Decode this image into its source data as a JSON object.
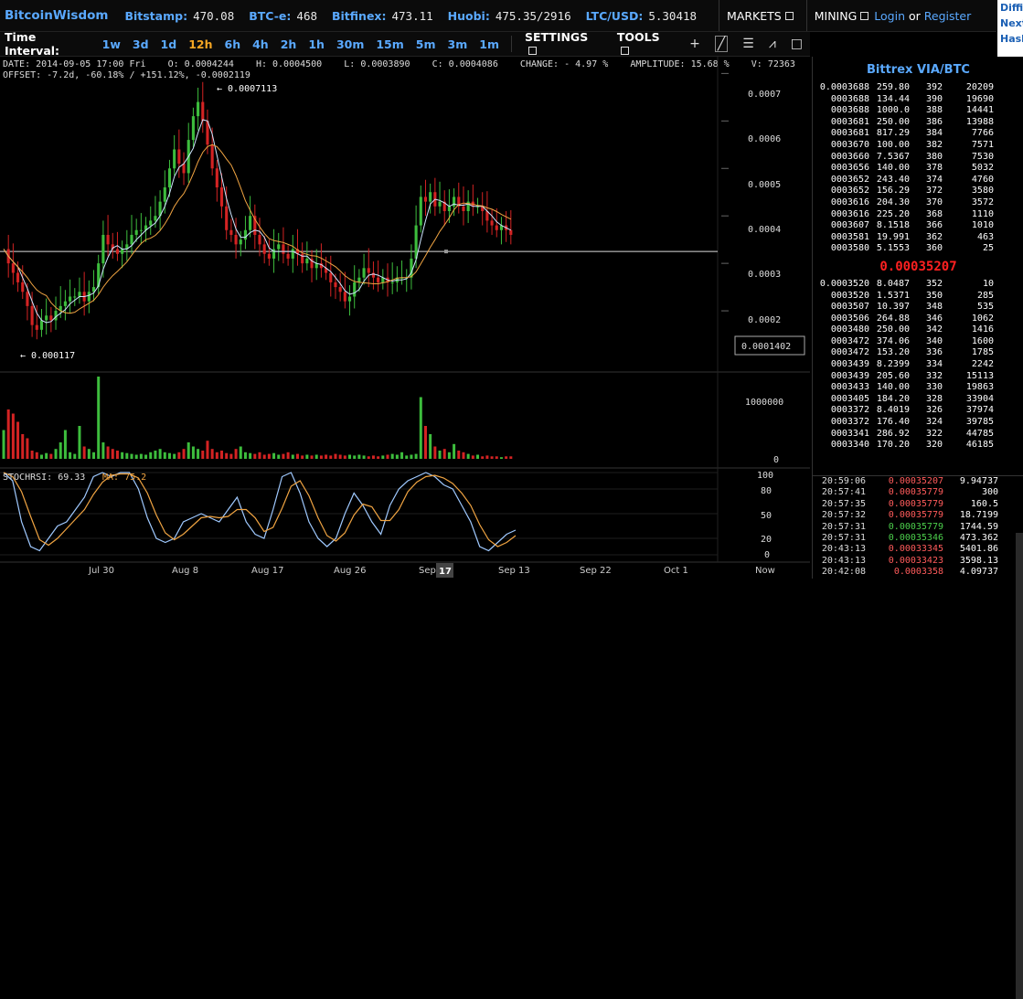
{
  "topbar": {
    "logo": "BitcoinWisdom",
    "exchanges": [
      {
        "name": "Bitstamp:",
        "price": "470.08"
      },
      {
        "name": "BTC-e:",
        "price": "468"
      },
      {
        "name": "Bitfinex:",
        "price": "473.11"
      },
      {
        "name": "Huobi:",
        "price": "475.35/2916"
      },
      {
        "name": "LTC/USD:",
        "price": "5.30418"
      }
    ],
    "markets_label": "MARKETS",
    "mining_label": "MINING",
    "login_label": "Login",
    "or_label": "or",
    "register_label": "Register"
  },
  "right_links": [
    "Diffi",
    "Next",
    "Hash"
  ],
  "intervals": {
    "label": "Time Interval:",
    "items": [
      "1w",
      "3d",
      "1d",
      "12h",
      "6h",
      "4h",
      "2h",
      "1h",
      "30m",
      "15m",
      "5m",
      "3m",
      "1m"
    ],
    "active": "12h",
    "settings_label": "SETTINGS",
    "tools_label": "TOOLS",
    "tool_icons": [
      "plus-icon",
      "line-tool-icon",
      "horizontal-lines-icon",
      "fan-icon",
      "square-icon"
    ]
  },
  "info": {
    "line1": "DATE: 2014-09-05 17:00 Fri    O: 0.0004244    H: 0.0004500    L: 0.0003890    C: 0.0004086    CHANGE: - 4.97 %    AMPLITUDE: 15.68 %    V: 72363",
    "line2": "OFFSET: -7.2d, -60.18% / +151.12%, -0.0002119"
  },
  "chart_data": {
    "type": "candlestick",
    "price_axis": {
      "ticks": [
        "0.0007",
        "0.0006",
        "0.0005",
        "0.0004",
        "0.0003",
        "0.0002"
      ],
      "range": [
        0.0001,
        0.00072
      ]
    },
    "high_label": "← 0.0007113",
    "low_label": "← 0.000117",
    "cursor_price": "0.0001402",
    "crosshair_price": 0.000325,
    "volume_axis": {
      "ticks": [
        "1000000",
        "0"
      ]
    },
    "stoch_label": "STOCHRSI: 69.33",
    "ma_label": "MA: 75.2",
    "stoch_axis": {
      "ticks": [
        "100",
        "80",
        "50",
        "20",
        "0"
      ]
    },
    "x_labels": [
      "Jul 30",
      "Aug 8",
      "Aug 17",
      "Aug 26",
      "Sep",
      "17",
      "Sep 13",
      "Sep 22",
      "Oct 1",
      "Now"
    ],
    "price_path": [
      0.00033,
      0.0003,
      0.00028,
      0.00026,
      0.00024,
      0.00021,
      0.00017,
      0.00016,
      0.00018,
      0.00019,
      0.00018,
      0.0002,
      0.00021,
      0.00022,
      0.00023,
      0.00023,
      0.00024,
      0.00022,
      0.00024,
      0.00025,
      0.0003,
      0.00036,
      0.00034,
      0.00033,
      0.00032,
      0.00033,
      0.00034,
      0.00036,
      0.00037,
      0.00037,
      0.00038,
      0.00039,
      0.0004,
      0.00043,
      0.00046,
      0.0005,
      0.00054,
      0.00051,
      0.00049,
      0.00056,
      0.00061,
      0.00064,
      0.0006,
      0.00055,
      0.0005,
      0.00046,
      0.00042,
      0.00037,
      0.00036,
      0.00034,
      0.00035,
      0.00037,
      0.0004,
      0.00036,
      0.00034,
      0.00032,
      0.00031,
      0.00033,
      0.00034,
      0.00032,
      0.00031,
      0.00033,
      0.00032,
      0.0003,
      0.00031,
      0.00029,
      0.0003,
      0.00029,
      0.00028,
      0.00026,
      0.00025,
      0.00024,
      0.00022,
      0.00023,
      0.00026,
      0.00027,
      0.00029,
      0.00028,
      0.00027,
      0.00026,
      0.00027,
      0.00026,
      0.00026,
      0.00027,
      0.00027,
      0.00027,
      0.00031,
      0.00038,
      0.00044,
      0.00043,
      0.00045,
      0.00042,
      0.00043,
      0.00041,
      0.00042,
      0.00044,
      0.00042,
      0.00041,
      0.00043,
      0.00042,
      0.00042,
      0.00041,
      0.00039,
      0.00038,
      0.00037,
      0.00038,
      0.00037,
      0.00036
    ],
    "volume_path": [
      0.35,
      0.6,
      0.55,
      0.45,
      0.3,
      0.25,
      0.1,
      0.08,
      0.05,
      0.07,
      0.06,
      0.12,
      0.2,
      0.35,
      0.08,
      0.06,
      0.4,
      0.15,
      0.12,
      0.08,
      1.0,
      0.2,
      0.15,
      0.12,
      0.1,
      0.08,
      0.07,
      0.06,
      0.05,
      0.06,
      0.05,
      0.08,
      0.1,
      0.12,
      0.08,
      0.07,
      0.06,
      0.08,
      0.12,
      0.2,
      0.15,
      0.12,
      0.1,
      0.22,
      0.12,
      0.08,
      0.1,
      0.07,
      0.06,
      0.12,
      0.15,
      0.08,
      0.07,
      0.06,
      0.08,
      0.05,
      0.06,
      0.07,
      0.05,
      0.06,
      0.08,
      0.05,
      0.06,
      0.04,
      0.05,
      0.04,
      0.05,
      0.04,
      0.05,
      0.04,
      0.06,
      0.05,
      0.04,
      0.05,
      0.04,
      0.05,
      0.04,
      0.03,
      0.04,
      0.03,
      0.04,
      0.05,
      0.06,
      0.05,
      0.08,
      0.04,
      0.05,
      0.06,
      0.75,
      0.4,
      0.3,
      0.15,
      0.1,
      0.12,
      0.08,
      0.18,
      0.1,
      0.08,
      0.06,
      0.04,
      0.05,
      0.03,
      0.04,
      0.03,
      0.03,
      0.02,
      0.03,
      0.03
    ],
    "stoch_path": [
      100,
      90,
      40,
      10,
      5,
      20,
      35,
      40,
      55,
      70,
      95,
      100,
      95,
      100,
      100,
      80,
      45,
      20,
      15,
      20,
      40,
      45,
      50,
      45,
      40,
      55,
      70,
      40,
      25,
      20,
      55,
      95,
      100,
      75,
      40,
      20,
      10,
      20,
      50,
      75,
      60,
      40,
      25,
      60,
      80,
      90,
      95,
      100,
      95,
      85,
      80,
      60,
      40,
      10,
      5,
      15,
      25,
      30
    ],
    "colors": {
      "up": "#3dbd3d",
      "down": "#d42323",
      "ma_fast": "#cfe6ff",
      "ma_slow": "#f0a442",
      "stoch": "#9fc9ff",
      "stoch_ma": "#f0a442"
    }
  },
  "book": {
    "title": "Bittrex VIA/BTC",
    "asks": [
      [
        "0.0003688",
        "259.80",
        "392",
        "20209"
      ],
      [
        "0003688",
        "134.44",
        "390",
        "19690"
      ],
      [
        "0003688",
        "1000.0",
        "388",
        "14441"
      ],
      [
        "0003681",
        "250.00",
        "386",
        "13988"
      ],
      [
        "0003681",
        "817.29",
        "384",
        "7766"
      ],
      [
        "0003670",
        "100.00",
        "382",
        "7571"
      ],
      [
        "0003660",
        "7.5367",
        "380",
        "7530"
      ],
      [
        "0003656",
        "140.00",
        "378",
        "5032"
      ],
      [
        "0003652",
        "243.40",
        "374",
        "4760"
      ],
      [
        "0003652",
        "156.29",
        "372",
        "3580"
      ],
      [
        "0003616",
        "204.30",
        "370",
        "3572"
      ],
      [
        "0003616",
        "225.20",
        "368",
        "1110"
      ],
      [
        "0003607",
        "8.1518",
        "366",
        "1010"
      ],
      [
        "0003581",
        "19.991",
        "362",
        "463"
      ],
      [
        "0003580",
        "5.1553",
        "360",
        "25"
      ]
    ],
    "last_price": "0.00035207",
    "bids": [
      [
        "0.0003520",
        "8.0487",
        "352",
        "10"
      ],
      [
        "0003520",
        "1.5371",
        "350",
        "285"
      ],
      [
        "0003507",
        "10.397",
        "348",
        "535"
      ],
      [
        "0003506",
        "264.88",
        "346",
        "1062"
      ],
      [
        "0003480",
        "250.00",
        "342",
        "1416"
      ],
      [
        "0003472",
        "374.06",
        "340",
        "1600"
      ],
      [
        "0003472",
        "153.20",
        "336",
        "1785"
      ],
      [
        "0003439",
        "8.2399",
        "334",
        "2242"
      ],
      [
        "0003439",
        "205.60",
        "332",
        "15113"
      ],
      [
        "0003433",
        "140.00",
        "330",
        "19863"
      ],
      [
        "0003405",
        "184.20",
        "328",
        "33904"
      ],
      [
        "0003372",
        "8.4019",
        "326",
        "37974"
      ],
      [
        "0003372",
        "176.40",
        "324",
        "39785"
      ],
      [
        "0003341",
        "286.92",
        "322",
        "44785"
      ],
      [
        "0003340",
        "170.20",
        "320",
        "46185"
      ]
    ],
    "trades": [
      [
        "20:59:06",
        "0.00035207",
        "9.94737",
        "red"
      ],
      [
        "20:57:41",
        "0.00035779",
        "300",
        "red"
      ],
      [
        "20:57:35",
        "0.00035779",
        "160.5",
        "red"
      ],
      [
        "20:57:32",
        "0.00035779",
        "18.7199",
        "red"
      ],
      [
        "20:57:31",
        "0.00035779",
        "1744.59",
        "green"
      ],
      [
        "20:57:31",
        "0.00035346",
        "473.362",
        "green"
      ],
      [
        "20:43:13",
        "0.00033345",
        "5401.86",
        "red"
      ],
      [
        "20:43:13",
        "0.00033423",
        "3598.13",
        "red"
      ],
      [
        "20:42:08",
        "0.0003358",
        "4.09737",
        "red"
      ]
    ]
  }
}
